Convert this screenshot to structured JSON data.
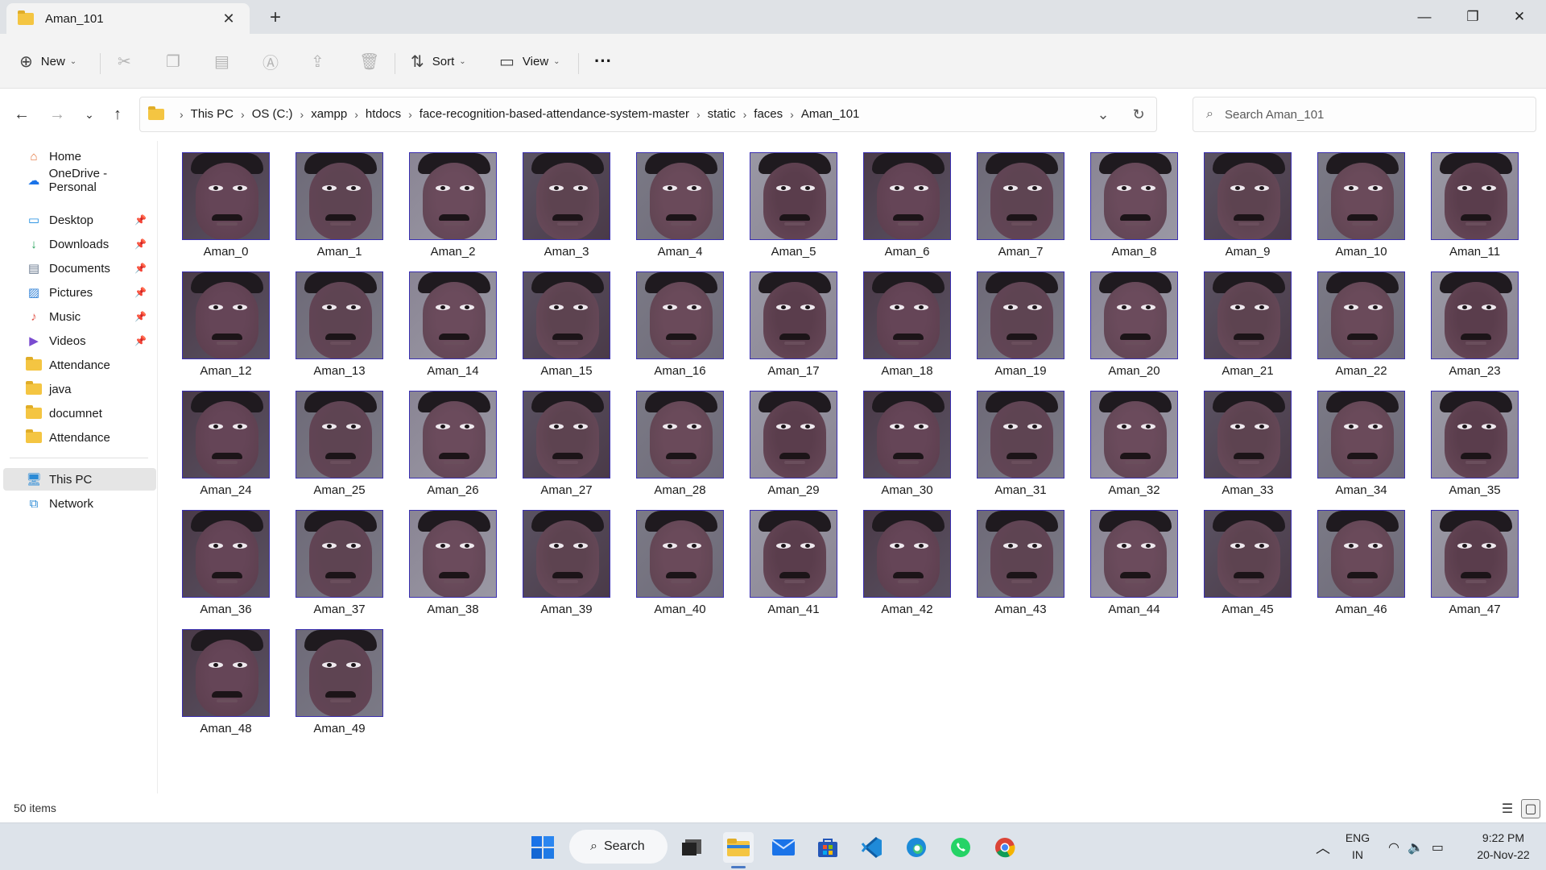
{
  "window": {
    "tab_title": "Aman_101",
    "tab_close": "✕",
    "new_tab": "+",
    "minimize": "—",
    "maximize": "❐",
    "close": "✕"
  },
  "toolbar": {
    "new_label": "New",
    "sort_label": "Sort",
    "view_label": "View",
    "more_label": "···",
    "icons": [
      "cut-icon",
      "copy-icon",
      "paste-icon",
      "rename-icon",
      "share-icon",
      "delete-icon"
    ]
  },
  "address": {
    "crumbs": [
      "This PC",
      "OS (C:)",
      "xampp",
      "htdocs",
      "face-recognition-based-attendance-system-master",
      "static",
      "faces",
      "Aman_101"
    ],
    "search_placeholder": "Search Aman_101"
  },
  "sidebar": {
    "quick": [
      {
        "label": "Home",
        "icon": "home-icon"
      },
      {
        "label": "OneDrive - Personal",
        "icon": "cloud-icon"
      }
    ],
    "pinned": [
      {
        "label": "Desktop",
        "icon": "desktop-icon",
        "pinned": true
      },
      {
        "label": "Downloads",
        "icon": "download-icon",
        "pinned": true
      },
      {
        "label": "Documents",
        "icon": "document-icon",
        "pinned": true
      },
      {
        "label": "Pictures",
        "icon": "picture-icon",
        "pinned": true
      },
      {
        "label": "Music",
        "icon": "music-icon",
        "pinned": true
      },
      {
        "label": "Videos",
        "icon": "video-icon",
        "pinned": true
      },
      {
        "label": "Attendance",
        "icon": "folder-icon",
        "pinned": false
      },
      {
        "label": "java",
        "icon": "folder-icon",
        "pinned": false
      },
      {
        "label": "documnet",
        "icon": "folder-icon",
        "pinned": false
      },
      {
        "label": "Attendance",
        "icon": "folder-icon",
        "pinned": false
      }
    ],
    "devices": [
      {
        "label": "This PC",
        "icon": "computer-icon",
        "selected": true
      },
      {
        "label": "Network",
        "icon": "network-icon",
        "selected": false
      }
    ]
  },
  "files": [
    "Aman_0",
    "Aman_1",
    "Aman_2",
    "Aman_3",
    "Aman_4",
    "Aman_5",
    "Aman_6",
    "Aman_7",
    "Aman_8",
    "Aman_9",
    "Aman_10",
    "Aman_11",
    "Aman_12",
    "Aman_13",
    "Aman_14",
    "Aman_15",
    "Aman_16",
    "Aman_17",
    "Aman_18",
    "Aman_19",
    "Aman_20",
    "Aman_21",
    "Aman_22",
    "Aman_23",
    "Aman_24",
    "Aman_25",
    "Aman_26",
    "Aman_27",
    "Aman_28",
    "Aman_29",
    "Aman_30",
    "Aman_31",
    "Aman_32",
    "Aman_33",
    "Aman_34",
    "Aman_35",
    "Aman_36",
    "Aman_37",
    "Aman_38",
    "Aman_39",
    "Aman_40",
    "Aman_41",
    "Aman_42",
    "Aman_43",
    "Aman_44",
    "Aman_45",
    "Aman_46",
    "Aman_47",
    "Aman_48",
    "Aman_49"
  ],
  "status": {
    "item_count": "50 items"
  },
  "taskbar": {
    "search_label": "Search",
    "lang_top": "ENG",
    "lang_bottom": "IN",
    "time": "9:22 PM",
    "date": "20-Nov-22",
    "apps": [
      "start-icon",
      "task-view-icon",
      "file-explorer-icon",
      "mail-icon",
      "store-icon",
      "vscode-icon",
      "edge-icon",
      "whatsapp-icon",
      "chrome-icon"
    ]
  },
  "colors": {
    "accent": "#0067c0",
    "folder": "#f4c542",
    "thumb_border": "#3a2fb0",
    "taskbar": "#dde3ea"
  }
}
